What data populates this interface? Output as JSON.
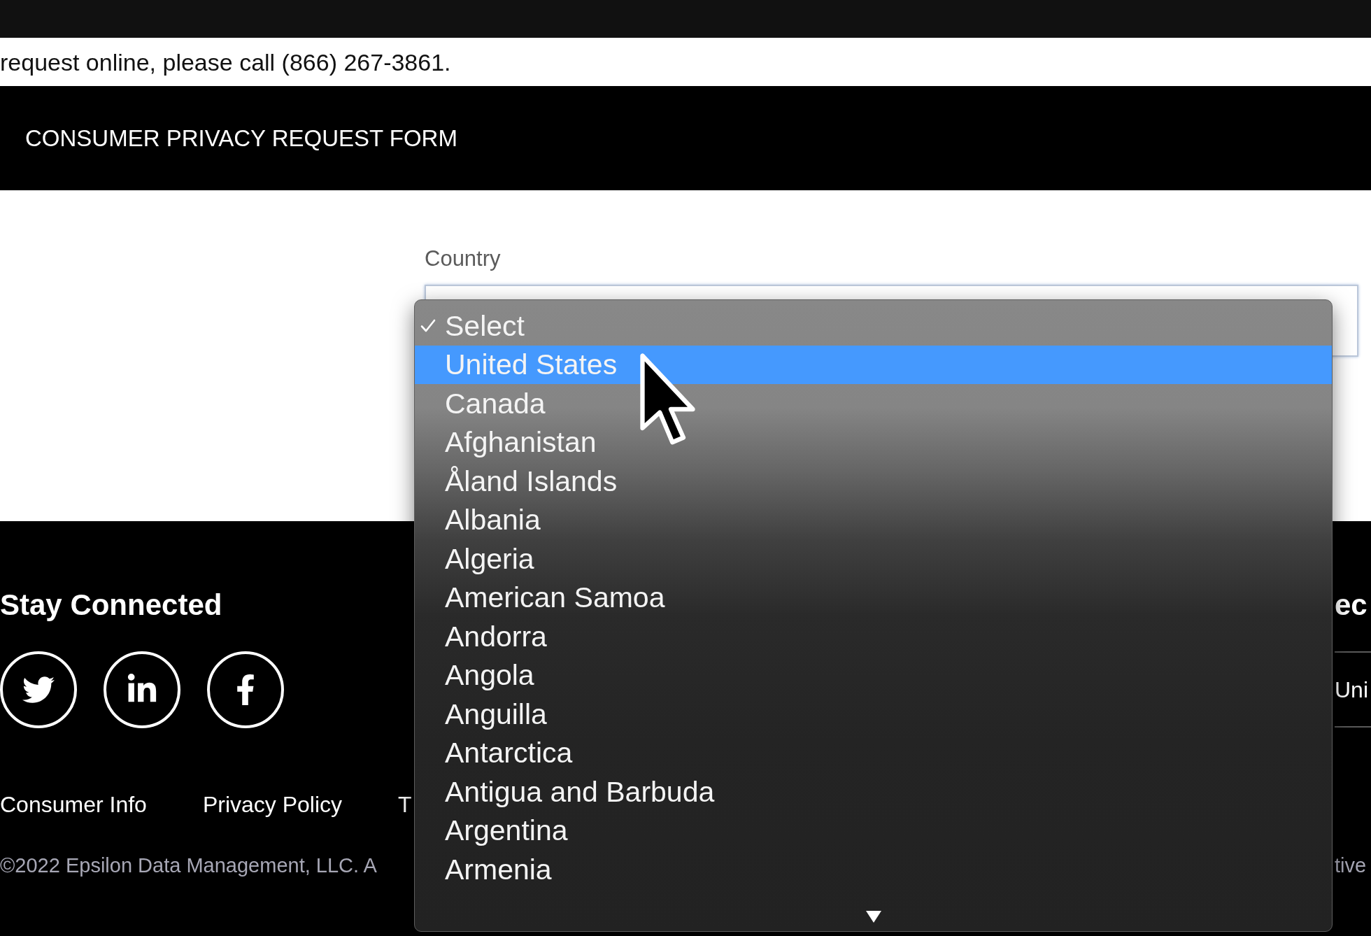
{
  "intro_text": "request online, please call (866) 267-3861.",
  "banner": {
    "title": "CONSUMER PRIVACY REQUEST FORM"
  },
  "form": {
    "country": {
      "label": "Country",
      "options": [
        {
          "label": "Select",
          "selected": true,
          "highlighted": false
        },
        {
          "label": "United States",
          "selected": false,
          "highlighted": true
        },
        {
          "label": "Canada",
          "selected": false,
          "highlighted": false
        },
        {
          "label": "Afghanistan",
          "selected": false,
          "highlighted": false
        },
        {
          "label": "Åland Islands",
          "selected": false,
          "highlighted": false
        },
        {
          "label": "Albania",
          "selected": false,
          "highlighted": false
        },
        {
          "label": "Algeria",
          "selected": false,
          "highlighted": false
        },
        {
          "label": "American Samoa",
          "selected": false,
          "highlighted": false
        },
        {
          "label": "Andorra",
          "selected": false,
          "highlighted": false
        },
        {
          "label": "Angola",
          "selected": false,
          "highlighted": false
        },
        {
          "label": "Anguilla",
          "selected": false,
          "highlighted": false
        },
        {
          "label": "Antarctica",
          "selected": false,
          "highlighted": false
        },
        {
          "label": "Antigua and Barbuda",
          "selected": false,
          "highlighted": false
        },
        {
          "label": "Argentina",
          "selected": false,
          "highlighted": false
        },
        {
          "label": "Armenia",
          "selected": false,
          "highlighted": false
        }
      ]
    }
  },
  "footer": {
    "heading": "Stay Connected",
    "links": [
      "Consumer Info",
      "Privacy Policy",
      "T"
    ],
    "copyright": "©2022 Epsilon Data Management, LLC. A",
    "right_column": {
      "heading": "ec",
      "link": "Uni",
      "text": "tive"
    }
  }
}
